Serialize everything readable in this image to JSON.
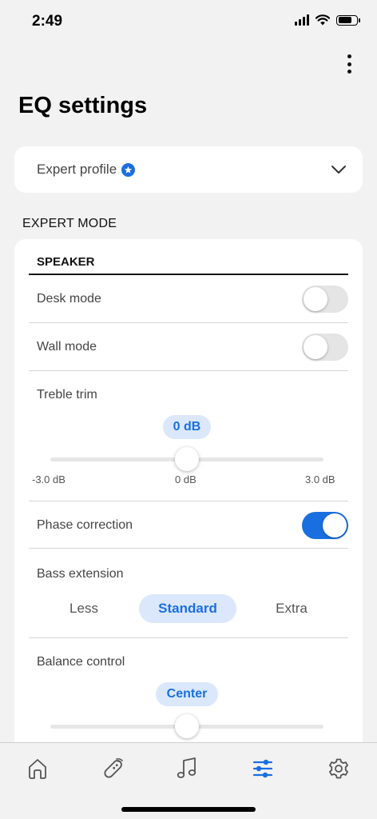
{
  "status_bar": {
    "time": "2:49"
  },
  "header": {
    "title": "EQ settings",
    "more_icon": "more-vertical-icon"
  },
  "profile": {
    "label": "Expert profile",
    "badge_icon": "star-badge-icon",
    "chevron_icon": "chevron-down-icon"
  },
  "mode_section": {
    "heading": "EXPERT MODE"
  },
  "speaker": {
    "heading": "SPEAKER",
    "desk_mode": {
      "label": "Desk mode",
      "enabled": false
    },
    "wall_mode": {
      "label": "Wall mode",
      "enabled": false
    },
    "treble_trim": {
      "label": "Treble trim",
      "value": "0 dB",
      "min_label": "-3.0 dB",
      "mid_label": "0 dB",
      "max_label": "3.0 dB",
      "level": 0.5
    },
    "phase_correction": {
      "label": "Phase correction",
      "enabled": true
    },
    "bass_extension": {
      "label": "Bass extension",
      "options": [
        "Less",
        "Standard",
        "Extra"
      ],
      "selected": "Standard"
    },
    "balance_control": {
      "label": "Balance control",
      "value": "Center",
      "level": 0.5
    }
  },
  "tab_bar": {
    "tabs": [
      {
        "name": "home",
        "icon": "home-icon"
      },
      {
        "name": "remote",
        "icon": "remote-icon"
      },
      {
        "name": "music",
        "icon": "music-note-icon"
      },
      {
        "name": "eq",
        "icon": "sliders-icon",
        "active": true
      },
      {
        "name": "settings",
        "icon": "gear-icon"
      }
    ]
  },
  "colors": {
    "accent": "#1a6fe0",
    "pill_bg": "#dbe8fb",
    "background": "#f2f2f2"
  }
}
